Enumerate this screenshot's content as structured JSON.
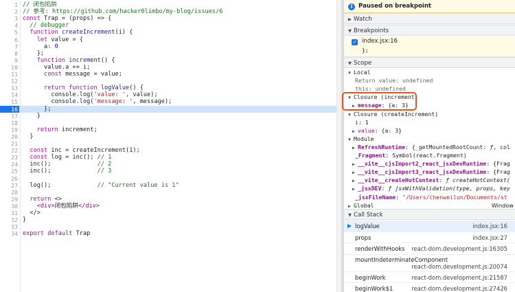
{
  "editor": {
    "active_line": 16,
    "lines": [
      {
        "n": "1",
        "segs": [
          {
            "c": "cm",
            "t": "// 闭包陷阱"
          }
        ]
      },
      {
        "n": "2",
        "segs": [
          {
            "c": "cm",
            "t": "// 参考: https://github.com/hacker0limbo/my-blog/issues/6"
          }
        ]
      },
      {
        "n": "3",
        "segs": [
          {
            "c": "kw",
            "t": "const "
          },
          {
            "c": "def",
            "t": "Trap = (props) => {"
          }
        ]
      },
      {
        "n": "4",
        "segs": [
          {
            "c": "cm",
            "t": "  // debugger"
          }
        ]
      },
      {
        "n": "5",
        "segs": [
          {
            "c": "kw",
            "t": "  function "
          },
          {
            "c": "fn",
            "t": "createIncrement"
          },
          {
            "c": "def",
            "t": "(i) {"
          }
        ]
      },
      {
        "n": "6",
        "segs": [
          {
            "c": "kw",
            "t": "    let "
          },
          {
            "c": "def",
            "t": "value = {"
          }
        ]
      },
      {
        "n": "7",
        "segs": [
          {
            "c": "def",
            "t": "      a: "
          },
          {
            "c": "num",
            "t": "0"
          }
        ]
      },
      {
        "n": "8",
        "segs": [
          {
            "c": "def",
            "t": "    };"
          }
        ]
      },
      {
        "n": "9",
        "segs": [
          {
            "c": "kw",
            "t": "    function "
          },
          {
            "c": "fn",
            "t": "increment"
          },
          {
            "c": "def",
            "t": "() {"
          }
        ]
      },
      {
        "n": "10",
        "segs": [
          {
            "c": "def",
            "t": "      value.a += i;"
          }
        ]
      },
      {
        "n": "11",
        "segs": [
          {
            "c": "kw",
            "t": "      const "
          },
          {
            "c": "def",
            "t": "message = value;"
          }
        ]
      },
      {
        "n": "12",
        "segs": [
          {
            "c": "def",
            "t": ""
          }
        ]
      },
      {
        "n": "13",
        "segs": [
          {
            "c": "kw",
            "t": "      return function "
          },
          {
            "c": "fn",
            "t": "logValue"
          },
          {
            "c": "def",
            "t": "() {"
          }
        ]
      },
      {
        "n": "14",
        "segs": [
          {
            "c": "def",
            "t": "        console.log("
          },
          {
            "c": "str",
            "t": "'value: '"
          },
          {
            "c": "def",
            "t": ", value);"
          }
        ]
      },
      {
        "n": "15",
        "segs": [
          {
            "c": "def",
            "t": "        console.log("
          },
          {
            "c": "str",
            "t": "'message: '"
          },
          {
            "c": "def",
            "t": ", message);"
          }
        ]
      },
      {
        "n": "16",
        "segs": [
          {
            "c": "def",
            "t": "      };"
          }
        ]
      },
      {
        "n": "17",
        "segs": [
          {
            "c": "def",
            "t": "    }"
          }
        ]
      },
      {
        "n": "18",
        "segs": [
          {
            "c": "def",
            "t": ""
          }
        ]
      },
      {
        "n": "19",
        "segs": [
          {
            "c": "kw",
            "t": "    return "
          },
          {
            "c": "def",
            "t": "increment;"
          }
        ]
      },
      {
        "n": "20",
        "segs": [
          {
            "c": "def",
            "t": "  }"
          }
        ]
      },
      {
        "n": "21",
        "segs": [
          {
            "c": "def",
            "t": ""
          }
        ]
      },
      {
        "n": "22",
        "segs": [
          {
            "c": "kw",
            "t": "  const "
          },
          {
            "c": "def",
            "t": "inc = createIncrement("
          },
          {
            "c": "num",
            "t": "1"
          },
          {
            "c": "def",
            "t": ");"
          }
        ]
      },
      {
        "n": "23",
        "segs": [
          {
            "c": "kw",
            "t": "  const "
          },
          {
            "c": "def",
            "t": "log = inc(); "
          },
          {
            "c": "cm",
            "t": "// 1"
          }
        ]
      },
      {
        "n": "24",
        "segs": [
          {
            "c": "def",
            "t": "  inc();             "
          },
          {
            "c": "cm",
            "t": "// 2"
          }
        ]
      },
      {
        "n": "25",
        "segs": [
          {
            "c": "def",
            "t": "  inc();             "
          },
          {
            "c": "cm",
            "t": "// 3"
          }
        ]
      },
      {
        "n": "26",
        "segs": [
          {
            "c": "def",
            "t": ""
          }
        ]
      },
      {
        "n": "27",
        "segs": [
          {
            "c": "def",
            "t": "  log();             "
          },
          {
            "c": "cm",
            "t": "// \"Current value is 1\""
          }
        ]
      },
      {
        "n": "28",
        "segs": [
          {
            "c": "def",
            "t": ""
          }
        ]
      },
      {
        "n": "29",
        "segs": [
          {
            "c": "kw",
            "t": "  return "
          },
          {
            "c": "def",
            "t": "<>"
          }
        ]
      },
      {
        "n": "30",
        "segs": [
          {
            "c": "tag",
            "t": "    <div>"
          },
          {
            "c": "def",
            "t": "闭包陷阱"
          },
          {
            "c": "tag",
            "t": "</div>"
          }
        ]
      },
      {
        "n": "31",
        "segs": [
          {
            "c": "def",
            "t": "  </>"
          }
        ]
      },
      {
        "n": "32",
        "segs": [
          {
            "c": "def",
            "t": "}"
          }
        ]
      },
      {
        "n": "33",
        "segs": [
          {
            "c": "def",
            "t": ""
          }
        ]
      },
      {
        "n": "34",
        "segs": [
          {
            "c": "kw",
            "t": "export default "
          },
          {
            "c": "def",
            "t": "Trap"
          }
        ]
      }
    ]
  },
  "panel": {
    "paused_label": "Paused on breakpoint",
    "watch_label": "Watch",
    "breakpoints_label": "Breakpoints",
    "breakpoint_file": "index.jsx:16",
    "breakpoint_code": "};",
    "scope_label": "Scope",
    "scope_rows": [
      {
        "indent": 6,
        "tri": "▼",
        "segs": [
          {
            "c": "",
            "t": "Local"
          }
        ]
      },
      {
        "indent": 16,
        "tri": "",
        "segs": [
          {
            "c": "muted",
            "t": "Return value: "
          },
          {
            "c": "muted",
            "t": "undefined"
          }
        ]
      },
      {
        "indent": 16,
        "tri": "",
        "segs": [
          {
            "c": "muted",
            "t": "this: "
          },
          {
            "c": "muted",
            "t": "undefined"
          }
        ]
      },
      {
        "indent": 6,
        "tri": "▼",
        "segs": [
          {
            "c": "",
            "t": "Closure (increment)"
          }
        ]
      },
      {
        "indent": 12,
        "tri": "▶",
        "segs": [
          {
            "c": "bold",
            "t": "message"
          },
          {
            "c": "",
            "t": ": {a: 3}"
          }
        ]
      },
      {
        "indent": 6,
        "tri": "▼",
        "segs": [
          {
            "c": "",
            "t": "Closure (createIncrement)"
          }
        ]
      },
      {
        "indent": 16,
        "tri": "",
        "segs": [
          {
            "c": "prop",
            "t": "i"
          },
          {
            "c": "",
            "t": ": "
          },
          {
            "c": "num",
            "t": "1"
          }
        ]
      },
      {
        "indent": 12,
        "tri": "▶",
        "segs": [
          {
            "c": "prop",
            "t": "value"
          },
          {
            "c": "",
            "t": ": {a: 3}"
          }
        ]
      },
      {
        "indent": 6,
        "tri": "▼",
        "segs": [
          {
            "c": "",
            "t": "Module"
          }
        ]
      },
      {
        "indent": 12,
        "tri": "▶",
        "segs": [
          {
            "c": "bold",
            "t": "RefreshRuntime"
          },
          {
            "c": "",
            "t": ": {_getMountedRootCount: "
          },
          {
            "c": "fn",
            "t": "ƒ"
          },
          {
            "c": "",
            "t": ", col"
          }
        ]
      },
      {
        "indent": 16,
        "tri": "",
        "segs": [
          {
            "c": "bold",
            "t": "_Fragment"
          },
          {
            "c": "",
            "t": ": Symbol(react.fragment)"
          }
        ]
      },
      {
        "indent": 12,
        "tri": "▶",
        "segs": [
          {
            "c": "bold",
            "t": "__vite__cjsImport2_react_jsxDevRuntime"
          },
          {
            "c": "",
            "t": ": {Frag"
          }
        ]
      },
      {
        "indent": 12,
        "tri": "▶",
        "segs": [
          {
            "c": "bold",
            "t": "__vite__cjsImport3_react_jsxDevRuntime"
          },
          {
            "c": "",
            "t": ": {Frag"
          }
        ]
      },
      {
        "indent": 12,
        "tri": "▶",
        "segs": [
          {
            "c": "bold",
            "t": "__vite__createHotContext"
          },
          {
            "c": "",
            "t": ": "
          },
          {
            "c": "fn",
            "t": "ƒ createHotContext("
          }
        ]
      },
      {
        "indent": 12,
        "tri": "▶",
        "segs": [
          {
            "c": "bold",
            "t": "_jsxDEV"
          },
          {
            "c": "",
            "t": ": "
          },
          {
            "c": "fn",
            "t": "ƒ jsxWithValidation(type, props, key"
          }
        ]
      },
      {
        "indent": 16,
        "tri": "",
        "segs": [
          {
            "c": "bold",
            "t": "_jsxFileName"
          },
          {
            "c": "",
            "t": ": "
          },
          {
            "c": "str",
            "t": "\"/Users/chenweilun/Documents/st"
          }
        ]
      },
      {
        "indent": 6,
        "tri": "▶",
        "segs": [
          {
            "c": "",
            "t": "Global"
          }
        ],
        "right": "Window"
      }
    ],
    "callstack_label": "Call Stack",
    "callstack": [
      {
        "fn": "logValue",
        "loc": "index.jsx:16",
        "active": true,
        "two": false
      },
      {
        "fn": "props",
        "loc": "index.jsx:27",
        "active": false,
        "two": false
      },
      {
        "fn": "renderWithHooks",
        "loc": "react-dom.development.js:16305",
        "active": false,
        "two": false
      },
      {
        "fn": "mountIndeterminateComponent",
        "loc": "react-dom.development.js:20074",
        "active": false,
        "two": true
      },
      {
        "fn": "beginWork",
        "loc": "react-dom.development.js:21587",
        "active": false,
        "two": false
      },
      {
        "fn": "beginWork$1",
        "loc": "react-dom.development.js:27426",
        "active": false,
        "two": false
      }
    ],
    "colors": {
      "accent": "#1a73e8",
      "highlight_box": "#e8541b",
      "paused_bg": "#fffbe5"
    }
  }
}
